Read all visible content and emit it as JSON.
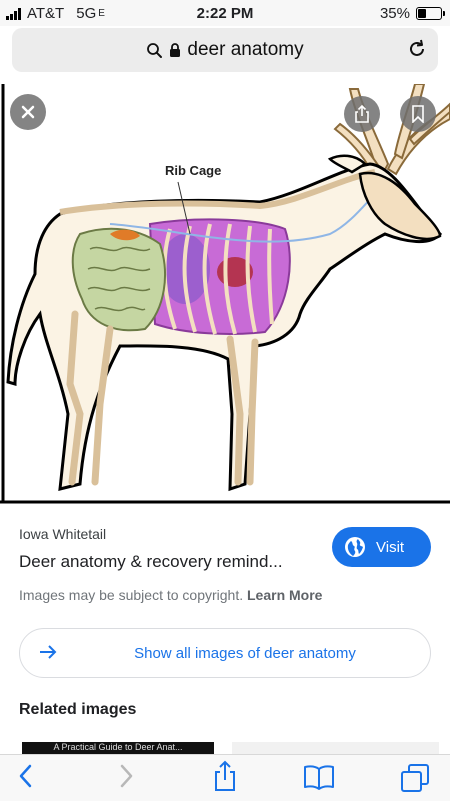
{
  "status": {
    "carrier": "AT&T",
    "network": "5G",
    "network_sub": "E",
    "time": "2:22 PM",
    "battery": "35%",
    "battery_level": 0.35
  },
  "browser": {
    "url": "deer anatomy"
  },
  "image": {
    "label": "Rib Cage"
  },
  "result": {
    "source": "Iowa Whitetail",
    "title": "Deer anatomy & recovery remind...",
    "copyright": "Images may be subject to copyright.",
    "learn_more": "Learn More",
    "visit_label": "Visit"
  },
  "show_all": {
    "label": "Show all images of deer anatomy"
  },
  "related": {
    "heading": "Related images",
    "thumb1_text": "A Practical Guide to Deer Anat..."
  },
  "icons": {
    "back": "chevron-left-icon",
    "forward": "chevron-right-icon",
    "share": "share-icon",
    "bookmarks": "book-icon",
    "tabs": "tabs-icon"
  },
  "colors": {
    "accent": "#1a73e8",
    "bone": "#f3dfc0",
    "stomach": "#c5d6a2",
    "lungs": "#c86bd6"
  }
}
